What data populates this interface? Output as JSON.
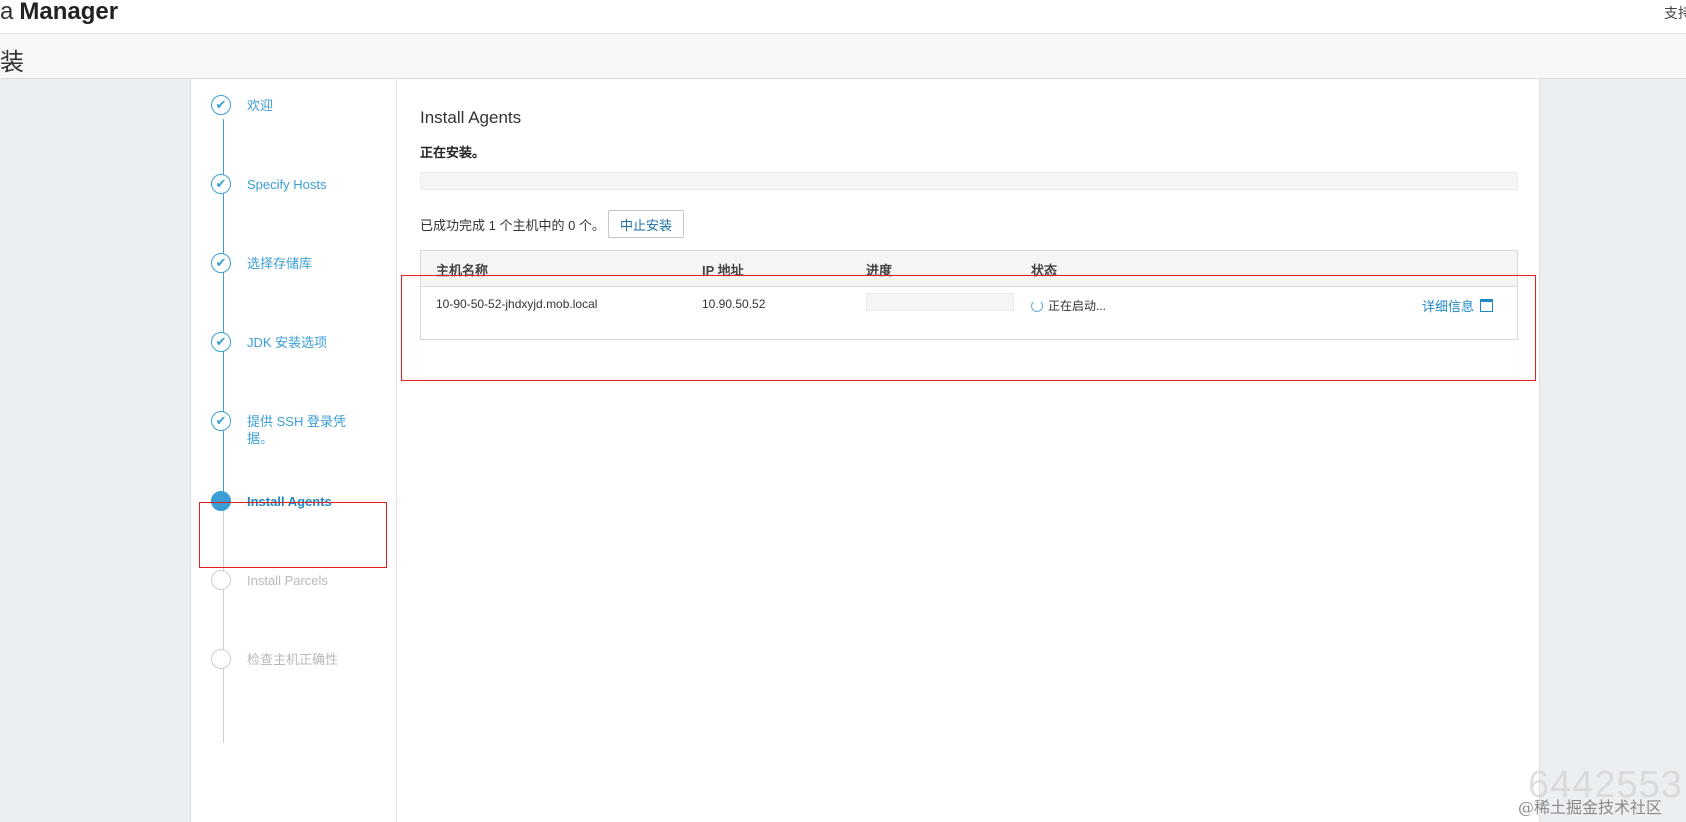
{
  "header": {
    "brand_prefix": "a",
    "brand_name": "Manager",
    "support": "支持"
  },
  "subheader": {
    "title": "装"
  },
  "steps": [
    {
      "label": "欢迎",
      "state": "done"
    },
    {
      "label": "Specify Hosts",
      "state": "done"
    },
    {
      "label": "选择存储库",
      "state": "done"
    },
    {
      "label": "JDK 安装选项",
      "state": "done"
    },
    {
      "label": "提供 SSH 登录凭据。",
      "state": "done"
    },
    {
      "label": "Install Agents",
      "state": "active"
    },
    {
      "label": "Install Parcels",
      "state": "pending"
    },
    {
      "label": "检查主机正确性",
      "state": "pending"
    }
  ],
  "icons": {
    "done": "checkmark-icon",
    "active": "filled-circle-icon",
    "pending": "empty-circle-icon",
    "details": "window-icon",
    "status": "spinner-icon"
  },
  "main": {
    "title": "Install Agents",
    "subtitle": "正在安装。",
    "overall_progress": 0,
    "summary": "已成功完成 1 个主机中的 0 个。",
    "abort_label": "中止安装"
  },
  "table": {
    "headers": {
      "hostname": "主机名称",
      "ip": "IP 地址",
      "progress": "进度",
      "status": "状态"
    },
    "rows": [
      {
        "hostname": "10-90-50-52-jhdxyjd.mob.local",
        "ip": "10.90.50.52",
        "progress": 0,
        "status": "正在启动...",
        "details_label": "详细信息"
      }
    ]
  },
  "colors": {
    "accent": "#3b9fd6",
    "highlight": "#e02020"
  },
  "watermark": {
    "number": "6442553",
    "text": "@稀土掘金技术社区"
  }
}
